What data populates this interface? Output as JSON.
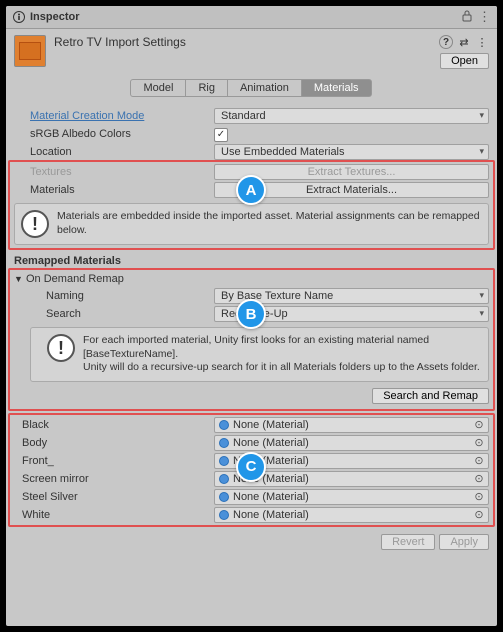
{
  "window": {
    "title": "Inspector"
  },
  "header": {
    "asset_title": "Retro TV Import Settings",
    "help_icon": "?",
    "prefab_icon": "⇄",
    "menu_icon": "⋮",
    "open_btn": "Open",
    "lock_icon": "🔒"
  },
  "tabs": [
    "Model",
    "Rig",
    "Animation",
    "Materials"
  ],
  "active_tab": 3,
  "fields": {
    "creation_mode_label": "Material Creation Mode",
    "creation_mode_value": "Standard",
    "srgb_label": "sRGB Albedo Colors",
    "srgb_checked": true,
    "location_label": "Location",
    "location_value": "Use Embedded Materials",
    "textures_label": "Textures",
    "textures_btn": "Extract Textures...",
    "materials_label": "Materials",
    "materials_btn": "Extract Materials..."
  },
  "info_embedded": "Materials are embedded inside the imported asset. Material assignments can be remapped below.",
  "remapped_title": "Remapped Materials",
  "remap": {
    "foldout": "On Demand Remap",
    "naming_label": "Naming",
    "naming_value": "By Base Texture Name",
    "search_label": "Search",
    "search_value": "Recursive-Up",
    "info": "For each imported material, Unity first looks for an existing material named [BaseTextureName].\nUnity will do a recursive-up search for it in all Materials folders up to the Assets folder.",
    "search_remap_btn": "Search and Remap"
  },
  "material_slots": [
    {
      "name": "Black",
      "value": "None (Material)"
    },
    {
      "name": "Body",
      "value": "None (Material)"
    },
    {
      "name": "Front_",
      "value": "None (Material)"
    },
    {
      "name": "Screen mirror",
      "value": "None (Material)"
    },
    {
      "name": "Steel Silver",
      "value": "None (Material)"
    },
    {
      "name": "White",
      "value": "None (Material)"
    }
  ],
  "footer": {
    "revert": "Revert",
    "apply": "Apply"
  },
  "callouts": {
    "a": "A",
    "b": "B",
    "c": "C"
  }
}
